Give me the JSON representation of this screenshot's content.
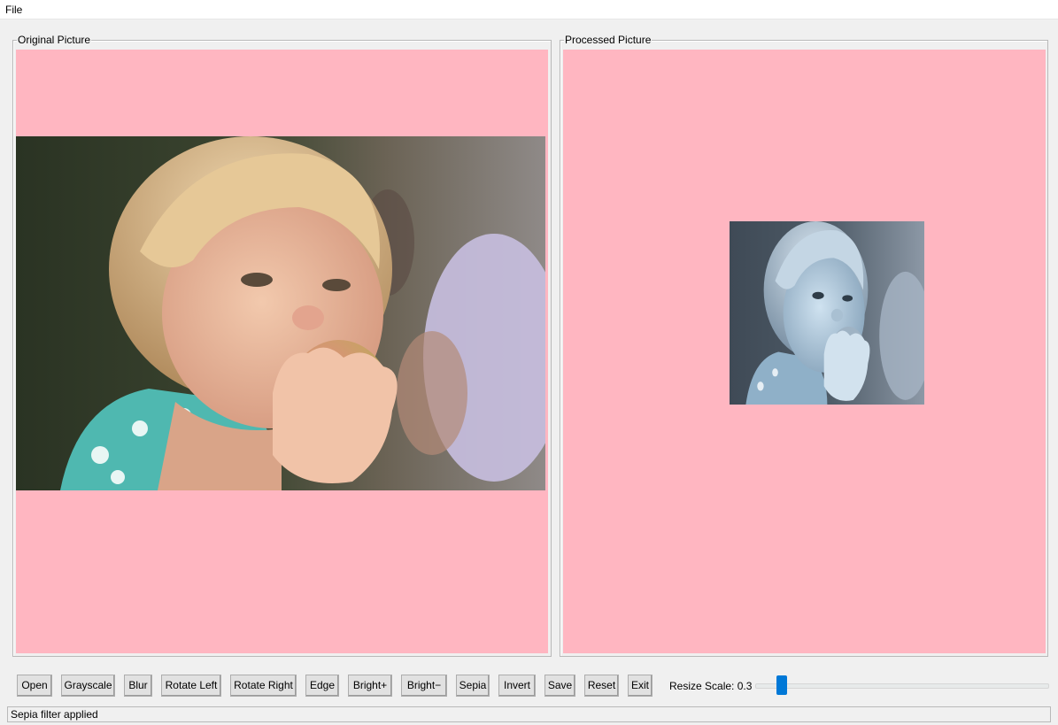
{
  "menu": {
    "items": [
      "File"
    ]
  },
  "panels": {
    "original": {
      "title": "Original Picture",
      "image": "photo of a blonde toddler biting an apple"
    },
    "processed": {
      "title": "Processed Picture",
      "image": "same photo, smaller, bluish-gray filtered"
    }
  },
  "toolbar": {
    "buttons": [
      {
        "id": "open",
        "label": "Open"
      },
      {
        "id": "grayscale",
        "label": "Grayscale"
      },
      {
        "id": "blur",
        "label": "Blur"
      },
      {
        "id": "rotate-left",
        "label": "Rotate Left"
      },
      {
        "id": "rotate-right",
        "label": "Rotate Right"
      },
      {
        "id": "edge",
        "label": "Edge"
      },
      {
        "id": "bright-plus",
        "label": "Bright+"
      },
      {
        "id": "bright-minus",
        "label": "Bright−"
      },
      {
        "id": "sepia",
        "label": "Sepia"
      },
      {
        "id": "invert",
        "label": "Invert"
      },
      {
        "id": "save",
        "label": "Save"
      },
      {
        "id": "reset",
        "label": "Reset"
      },
      {
        "id": "exit",
        "label": "Exit"
      }
    ],
    "resize_label": "Resize Scale: 0.3",
    "resize_value": 0.3
  },
  "status": {
    "text": "Sepia filter applied"
  },
  "colors": {
    "canvas_bg": "#ffb6c1",
    "window_bg": "#f0f0f0",
    "slider_thumb": "#0078d7"
  }
}
